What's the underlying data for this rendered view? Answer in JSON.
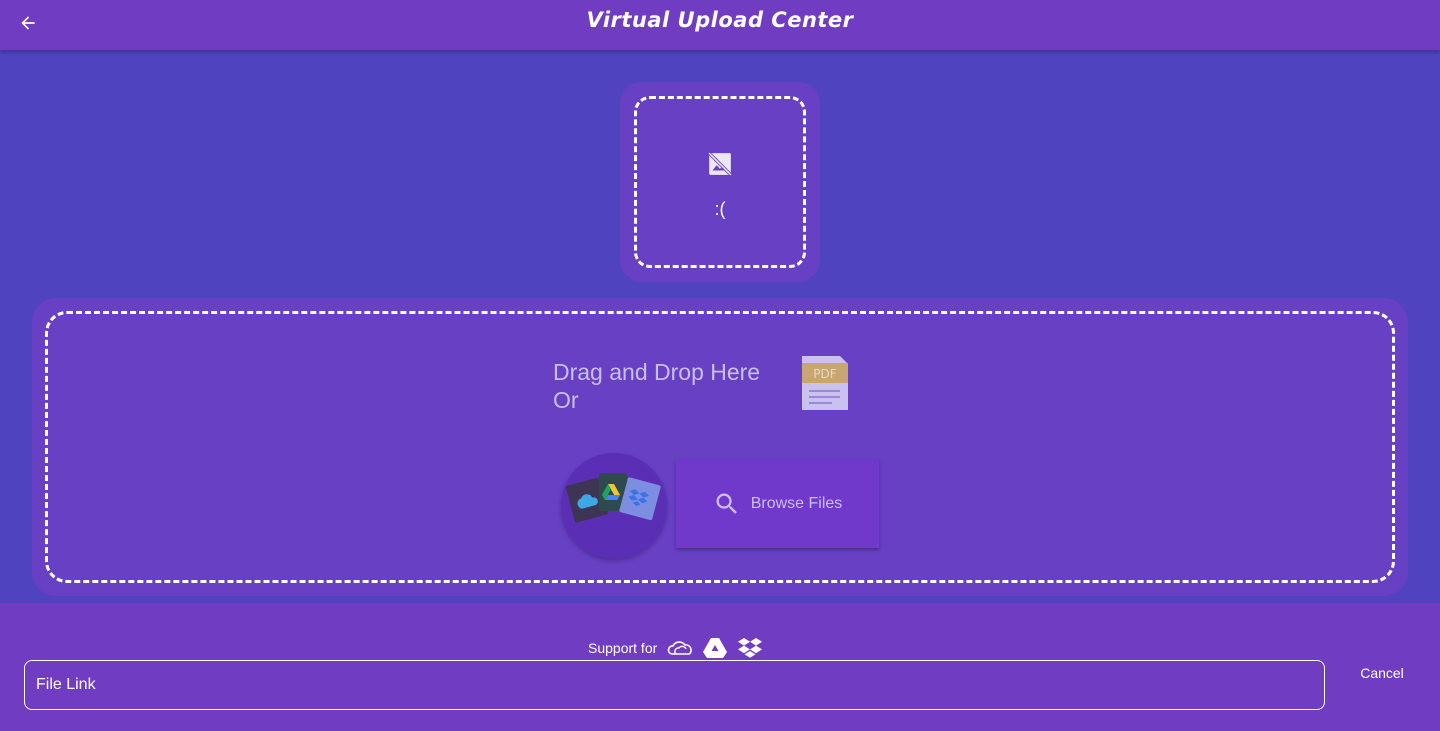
{
  "app": {
    "title": "Virtual Upload Center"
  },
  "preview": {
    "placeholder_text": ":("
  },
  "dropzone": {
    "line1": "Drag and Drop Here",
    "line2": "Or",
    "pdf_icon_label": "PDF",
    "browse_label": "Browse Files",
    "cloud_icons": [
      "onedrive-icon",
      "google-drive-icon",
      "dropbox-icon"
    ]
  },
  "footer": {
    "support_label": "Support for",
    "support_icons": [
      "onedrive-icon",
      "google-drive-icon",
      "dropbox-icon"
    ],
    "file_link_placeholder": "File Link",
    "cancel_label": "Cancel"
  },
  "colors": {
    "background": "#4f43c0",
    "appbar": "#6f3cc2",
    "panel": "#6740c4",
    "button": "#7138cc",
    "muted_text": "#c8bff0"
  }
}
